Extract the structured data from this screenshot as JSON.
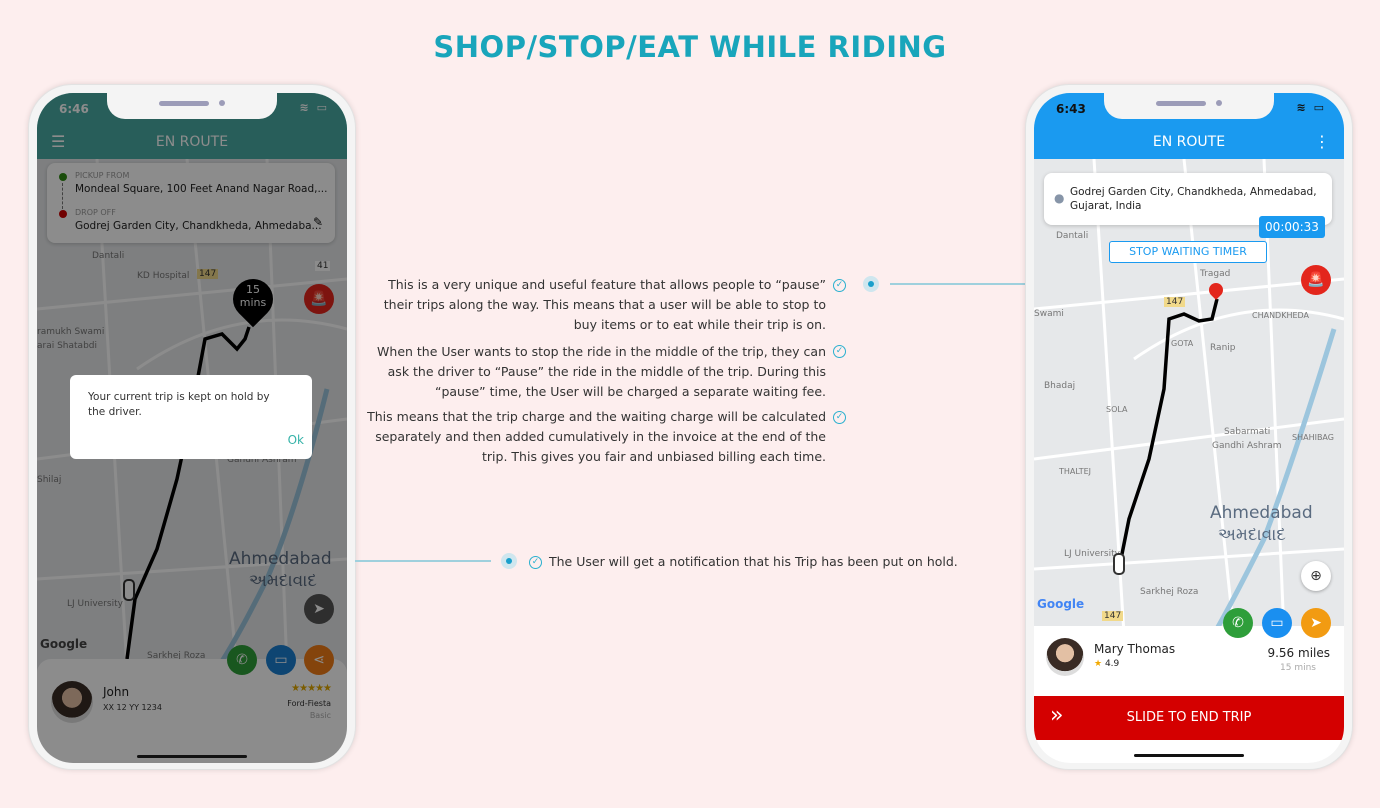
{
  "page_title": "SHOP/STOP/EAT WHILE RIDING",
  "features": [
    "This is a very unique and useful feature that allows people to “pause” their trips along the way. This means that a user will be able to stop to buy items or to eat while their trip is on.",
    "When the User wants to stop the ride in the middle of the trip, they can ask the driver to “Pause” the ride in the middle of the trip. During this “pause” time, the User will be charged a separate waiting fee.",
    "This means that the trip charge and the waiting charge will be calculated separately and then added cumulatively in the invoice at the end of the trip. This gives you fair and unbiased billing each time."
  ],
  "notification_note": "The User will get a notification that his Trip has been put on hold.",
  "colors": {
    "accent": "#19a5bb",
    "left_header": "#4aaba4",
    "right_header": "#1a9af0",
    "end_trip": "#d40000"
  },
  "left_phone": {
    "time": "6:46",
    "header": "EN ROUTE",
    "pickup_label": "PICKUP FROM",
    "pickup": "Mondeal Square, 100 Feet Anand Nagar Road,...",
    "drop_label": "DROP OFF",
    "drop": "Godrej Garden City, Chandkheda, Ahmedaba...",
    "eta_value": "15",
    "eta_unit": "mins",
    "map_labels": {
      "hospital": "KD Hospital",
      "swami": "ramukh Swami",
      "shatabdi": "arai Shatabdi",
      "city": "Ahmedabad",
      "city_local": "અમદાવાદ",
      "ashram": "Gandhi Ashram",
      "shilaj": "Shilaj",
      "lj": "LJ University",
      "roza": "Sarkhej Roza",
      "hw147": "147",
      "hw41": "41",
      "dantali": "Dantali",
      "google": "Google"
    },
    "dialog": {
      "message": "Your current trip is kept on hold by the driver.",
      "ok": "Ok"
    },
    "driver": {
      "name": "John",
      "plate": "XX 12 YY 1234",
      "rating": "★★★★★",
      "car": "Ford-Fiesta",
      "type": "Basic"
    }
  },
  "right_phone": {
    "time": "6:43",
    "header": "EN ROUTE",
    "destination": "Godrej Garden City, Chandkheda, Ahmedabad, Gujarat, India",
    "timer": "00:00:33",
    "stop_timer": "STOP WAITING TIMER",
    "map_labels": {
      "dantali": "Dantali",
      "tragad": "Tragad",
      "chandkheda": "CHANDKHEDA",
      "swami": "Swami",
      "gota": "GOTA",
      "ranip": "Ranip",
      "bhadaj": "Bhadaj",
      "sola": "SOLA",
      "sabarmati": "Sabarmati",
      "ashram": "Gandhi Ashram",
      "shahibag": "SHAHIBAG",
      "thaltej": "THALTEJ",
      "city": "Ahmedabad",
      "city_local": "અમદાવાદ",
      "lj": "LJ University",
      "roza": "Sarkhej Roza",
      "hw147": "147",
      "google": "Google"
    },
    "rider": {
      "name": "Mary Thomas",
      "rating": "4.9",
      "distance": "9.56 miles",
      "duration": "15 mins"
    },
    "end_trip": "SLIDE TO END TRIP"
  }
}
